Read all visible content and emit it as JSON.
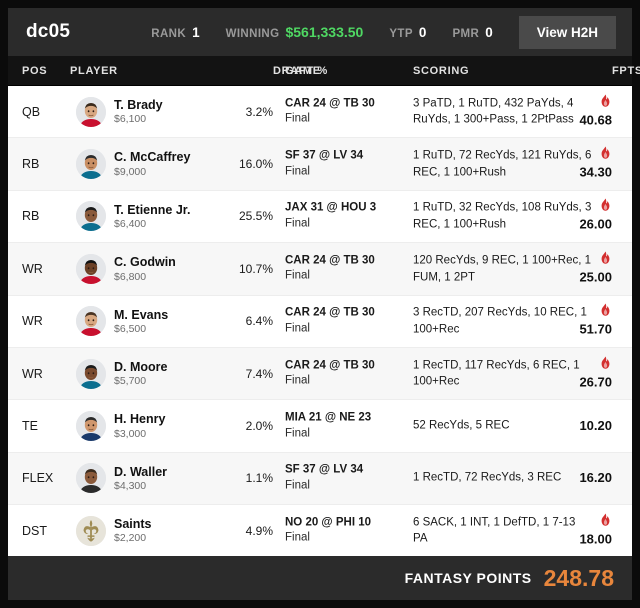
{
  "header": {
    "team_name": "dc05",
    "metrics": [
      {
        "label": "RANK",
        "value": "1",
        "style": "plain"
      },
      {
        "label": "WINNING",
        "value": "$561,333.50",
        "style": "money"
      },
      {
        "label": "YTP",
        "value": "0",
        "style": "plain"
      },
      {
        "label": "PMR",
        "value": "0",
        "style": "plain"
      }
    ],
    "h2h_button": "View H2H"
  },
  "columns": {
    "pos": "POS",
    "player": "PLAYER",
    "draft": "DRAFT %",
    "game": "GAME",
    "scoring": "SCORING",
    "fpts": "FPTS"
  },
  "colors": {
    "winning_green": "#4fd863",
    "total_orange": "#e8863c",
    "flame_red": "#d32f2f",
    "header_bg": "#2b2b2b",
    "row_alt_bg": "#f7f7f7"
  },
  "rows": [
    {
      "pos": "QB",
      "name": "T. Brady",
      "salary": "$6,100",
      "draft_pct": "3.2%",
      "game": "CAR 24 @ TB 30",
      "game_status": "Final",
      "scoring": "3 PaTD, 1 RuTD, 432 PaYds, 4 RuYds, 1 300+Pass, 1 2PtPass",
      "fpts": "40.68",
      "hot": true,
      "avatar": "player-headshot"
    },
    {
      "pos": "RB",
      "name": "C. McCaffrey",
      "salary": "$9,000",
      "draft_pct": "16.0%",
      "game": "SF 37 @ LV 34",
      "game_status": "Final",
      "scoring": "1 RuTD, 72 RecYds, 121 RuYds, 6 REC, 1 100+Rush",
      "fpts": "34.30",
      "hot": true,
      "avatar": "player-headshot"
    },
    {
      "pos": "RB",
      "name": "T. Etienne Jr.",
      "salary": "$6,400",
      "draft_pct": "25.5%",
      "game": "JAX 31 @ HOU 3",
      "game_status": "Final",
      "scoring": "1 RuTD, 32 RecYds, 108 RuYds, 3 REC, 1 100+Rush",
      "fpts": "26.00",
      "hot": true,
      "avatar": "player-headshot"
    },
    {
      "pos": "WR",
      "name": "C. Godwin",
      "salary": "$6,800",
      "draft_pct": "10.7%",
      "game": "CAR 24 @ TB 30",
      "game_status": "Final",
      "scoring": "120 RecYds, 9 REC, 1 100+Rec, 1 FUM, 1 2PT",
      "fpts": "25.00",
      "hot": true,
      "avatar": "player-headshot"
    },
    {
      "pos": "WR",
      "name": "M. Evans",
      "salary": "$6,500",
      "draft_pct": "6.4%",
      "game": "CAR 24 @ TB 30",
      "game_status": "Final",
      "scoring": "3 RecTD, 207 RecYds, 10 REC, 1 100+Rec",
      "fpts": "51.70",
      "hot": true,
      "avatar": "player-headshot"
    },
    {
      "pos": "WR",
      "name": "D. Moore",
      "salary": "$5,700",
      "draft_pct": "7.4%",
      "game": "CAR 24 @ TB 30",
      "game_status": "Final",
      "scoring": "1 RecTD, 117 RecYds, 6 REC, 1 100+Rec",
      "fpts": "26.70",
      "hot": true,
      "avatar": "player-headshot"
    },
    {
      "pos": "TE",
      "name": "H. Henry",
      "salary": "$3,000",
      "draft_pct": "2.0%",
      "game": "MIA 21 @ NE 23",
      "game_status": "Final",
      "scoring": "52 RecYds, 5 REC",
      "fpts": "10.20",
      "hot": false,
      "avatar": "player-headshot"
    },
    {
      "pos": "FLEX",
      "name": "D. Waller",
      "salary": "$4,300",
      "draft_pct": "1.1%",
      "game": "SF 37 @ LV 34",
      "game_status": "Final",
      "scoring": "1 RecTD, 72 RecYds, 3 REC",
      "fpts": "16.20",
      "hot": false,
      "avatar": "player-headshot"
    },
    {
      "pos": "DST",
      "name": "Saints",
      "salary": "$2,200",
      "draft_pct": "4.9%",
      "game": "NO 20 @ PHI 10",
      "game_status": "Final",
      "scoring": "6 SACK, 1 INT, 1 DefTD, 1 7-13 PA",
      "fpts": "18.00",
      "hot": true,
      "avatar": "team-logo-saints"
    }
  ],
  "footer": {
    "label": "FANTASY POINTS",
    "total": "248.78"
  }
}
